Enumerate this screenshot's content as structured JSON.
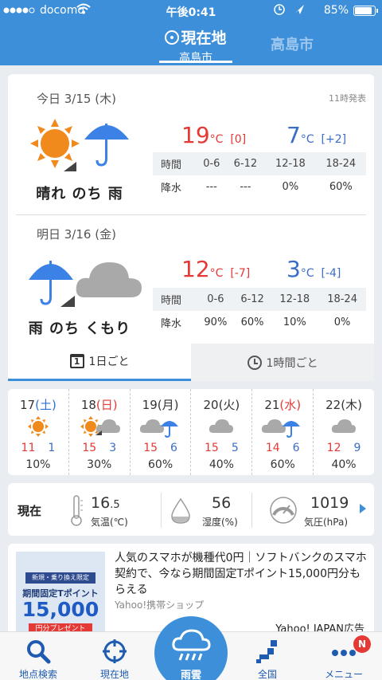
{
  "status_bar": {
    "carrier": "docomo",
    "time": "午後0:41",
    "battery": "85%"
  },
  "header": {
    "current_location_title": "現在地",
    "current_location_sub": "高島市",
    "other_location": "高島市"
  },
  "forecast": {
    "issued": "11時発表",
    "days": [
      {
        "label": "今日 3/15 (木)",
        "weather": "晴れ のち 雨",
        "icon1": "sun-icon",
        "icon2": "umbrella-icon",
        "high": "19",
        "high_diff": "[0]",
        "low": "7",
        "low_diff": "[+2]",
        "unit": "°C",
        "periods": [
          "0-6",
          "6-12",
          "12-18",
          "18-24"
        ],
        "rain": [
          "---",
          "---",
          "0%",
          "60%"
        ]
      },
      {
        "label": "明日 3/16 (金)",
        "weather": "雨 のち くもり",
        "icon1": "umbrella-icon",
        "icon2": "cloud-icon",
        "high": "12",
        "high_diff": "[-7]",
        "low": "3",
        "low_diff": "[-4]",
        "unit": "°C",
        "periods": [
          "0-6",
          "6-12",
          "12-18",
          "18-24"
        ],
        "rain": [
          "90%",
          "60%",
          "10%",
          "0%"
        ]
      }
    ],
    "time_header": "時間",
    "rain_header": "降水"
  },
  "tabs": {
    "daily": "1日ごと",
    "daily_icon_num": "1",
    "hourly": "1時間ごと"
  },
  "weekly": [
    {
      "day": "17",
      "dow": "(土)",
      "dow_type": "sat",
      "icons": [
        "sun-icon"
      ],
      "high": "11",
      "low": "1",
      "pop": "10%"
    },
    {
      "day": "18",
      "dow": "(日)",
      "dow_type": "sun",
      "icons": [
        "sun-icon",
        "cloud-icon"
      ],
      "high": "15",
      "low": "3",
      "pop": "30%"
    },
    {
      "day": "19",
      "dow": "(月)",
      "dow_type": "",
      "icons": [
        "cloud-icon",
        "umbrella-icon"
      ],
      "high": "15",
      "low": "6",
      "pop": "60%"
    },
    {
      "day": "20",
      "dow": "(火)",
      "dow_type": "",
      "icons": [
        "cloud-icon"
      ],
      "high": "15",
      "low": "5",
      "pop": "40%"
    },
    {
      "day": "21",
      "dow": "(水)",
      "dow_type": "sun",
      "icons": [
        "cloud-icon",
        "umbrella-icon"
      ],
      "high": "14",
      "low": "6",
      "pop": "60%"
    },
    {
      "day": "22",
      "dow": "(木)",
      "dow_type": "",
      "icons": [
        "cloud-icon"
      ],
      "high": "12",
      "low": "9",
      "pop": "40%"
    }
  ],
  "current": {
    "label": "現在",
    "temp": "16",
    "temp_dec": ".5",
    "temp_label": "気温(℃)",
    "humidity": "56",
    "humidity_label": "湿度(%)",
    "pressure": "1019",
    "pressure_label": "気圧(hPa)"
  },
  "ad": {
    "img_tag": "新規・乗り換え限定",
    "img_caption": "期間固定Tポイント",
    "img_big": "15,000",
    "img_small": "円分プレゼント",
    "text": "人気のスマホが機種代0円｜ソフトバンクのスマホ契約で、今なら期間固定Tポイント15,000円分もらえる",
    "source": "Yahoo!携帯ショップ",
    "credit": "Yahoo! JAPAN広告"
  },
  "nav": {
    "search": "地点検索",
    "current": "現在地",
    "rain": "雨雲",
    "nation": "全国",
    "menu": "メニュー",
    "badge": "N"
  },
  "colors": {
    "primary": "#3e8fd9",
    "high": "#e53935",
    "low": "#3a6dc4"
  }
}
